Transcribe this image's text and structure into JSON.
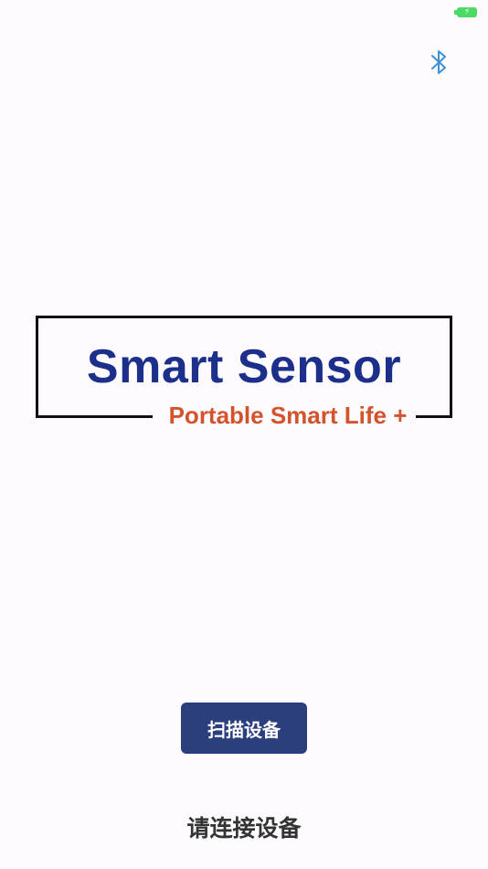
{
  "status_bar": {
    "battery_icon": "battery-charging-icon"
  },
  "header": {
    "bluetooth_icon": "bluetooth-icon",
    "bluetooth_color": "#3d8fd6"
  },
  "logo": {
    "title": "Smart Sensor",
    "tagline": "Portable Smart Life +",
    "title_color": "#1c2f8a",
    "tagline_color": "#d2532c"
  },
  "actions": {
    "scan_label": "扫描设备",
    "scan_color": "#2b3f7f"
  },
  "status": {
    "connect_prompt": "请连接设备"
  }
}
